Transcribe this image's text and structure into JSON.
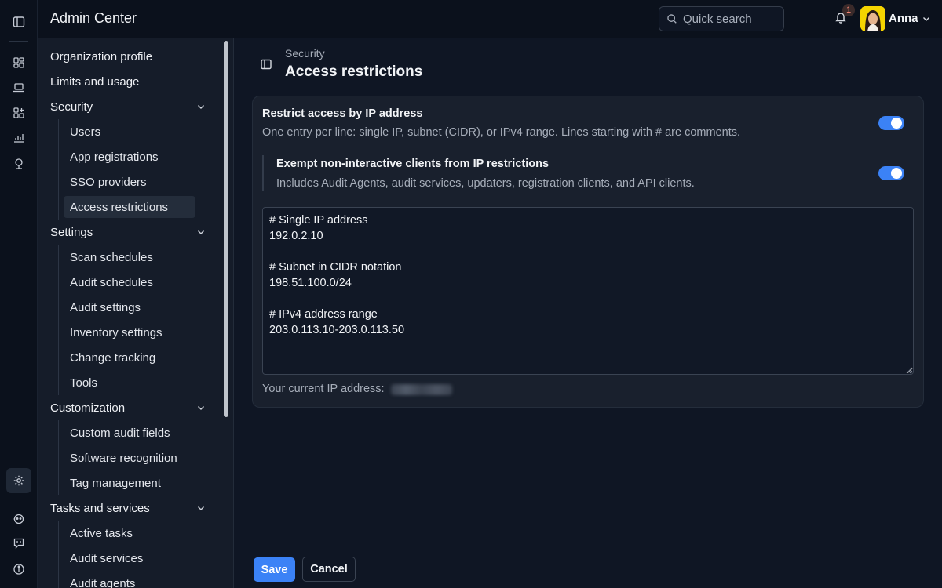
{
  "header": {
    "app_title": "Admin Center",
    "search_placeholder": "Quick search",
    "notification_count": "1",
    "user_name": "Anna"
  },
  "rail": {
    "icons": [
      "sidebar-toggle-icon",
      "dashboard-icon",
      "laptop-icon",
      "apps-icon",
      "reports-icon",
      "network-icon",
      "settings-icon",
      "support-icon",
      "feedback-icon",
      "info-icon"
    ]
  },
  "sidebar": {
    "top_items": [
      "Organization profile",
      "Limits and usage"
    ],
    "sections": [
      {
        "label": "Security",
        "items": [
          "Users",
          "App registrations",
          "SSO providers",
          "Access restrictions"
        ]
      },
      {
        "label": "Settings",
        "items": [
          "Scan schedules",
          "Audit schedules",
          "Audit settings",
          "Inventory settings",
          "Change tracking",
          "Tools"
        ]
      },
      {
        "label": "Customization",
        "items": [
          "Custom audit fields",
          "Software recognition",
          "Tag management"
        ]
      },
      {
        "label": "Tasks and services",
        "items": [
          "Active tasks",
          "Audit services",
          "Audit agents"
        ]
      }
    ],
    "active_item": "Access restrictions"
  },
  "main": {
    "breadcrumb": "Security",
    "title": "Access restrictions",
    "restrict_ip": {
      "title": "Restrict access by IP address",
      "description": "One entry per line: single IP, subnet (CIDR), or IPv4 range. Lines starting with # are comments.",
      "enabled": true
    },
    "exempt": {
      "title": "Exempt non-interactive clients from IP restrictions",
      "description": "Includes Audit Agents, audit services, updaters, registration clients, and API clients.",
      "enabled": true
    },
    "ip_list": "# Single IP address\n192.0.2.10\n\n# Subnet in CIDR notation\n198.51.100.0/24\n\n# IPv4 address range\n203.0.113.10-203.0.113.50",
    "current_ip_label": "Your current IP address:",
    "save_label": "Save",
    "cancel_label": "Cancel"
  },
  "colors": {
    "accent": "#3b82f6",
    "background": "#0f1624",
    "panel": "#19202d"
  }
}
